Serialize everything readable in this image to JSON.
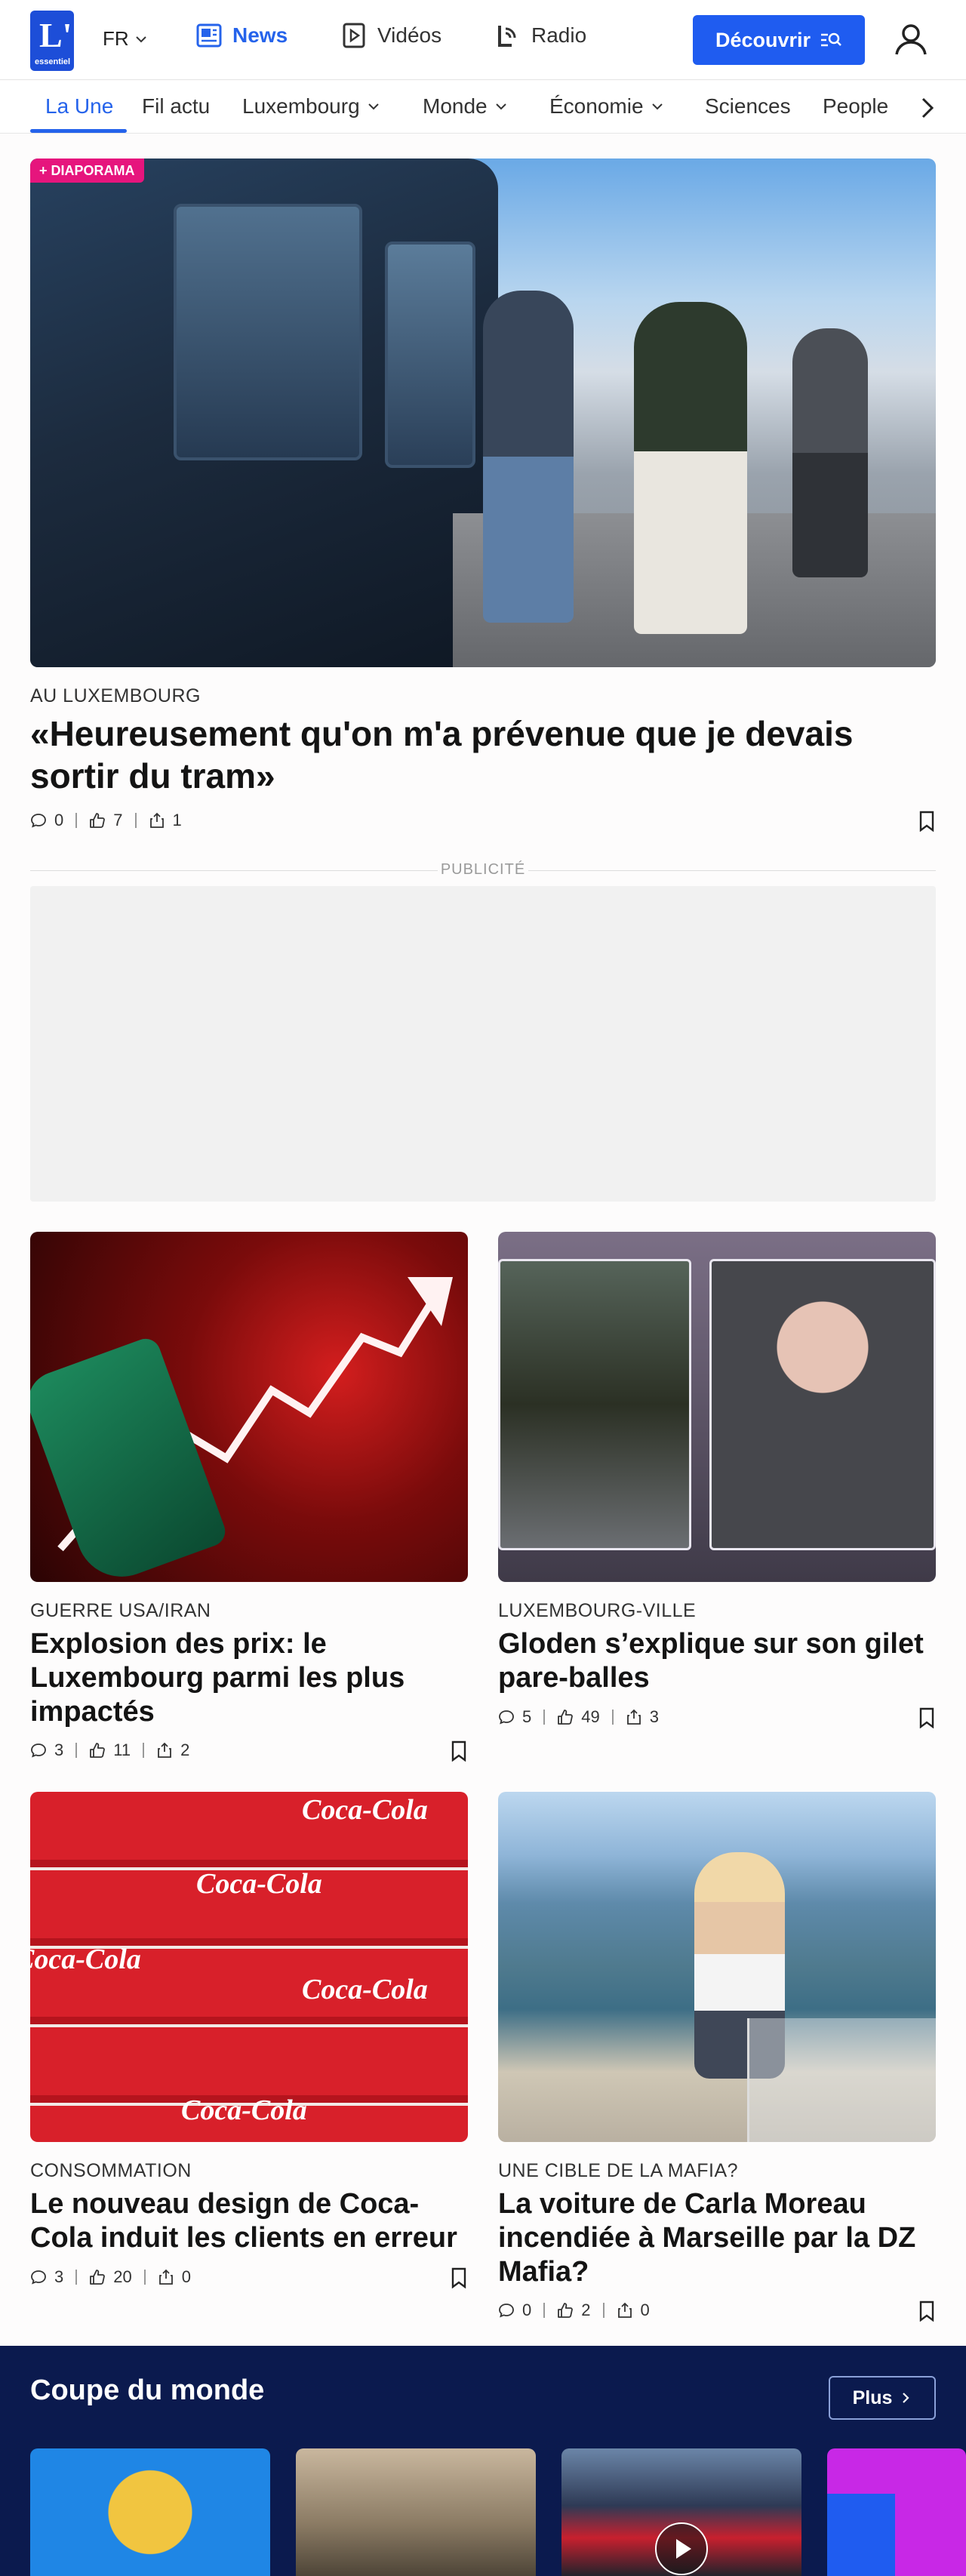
{
  "header": {
    "logo_big": "L'",
    "logo_small": "essentiel",
    "lang": "FR",
    "nav": [
      {
        "label": "News",
        "active": true
      },
      {
        "label": "Vidéos",
        "active": false
      },
      {
        "label": "Radio",
        "active": false
      }
    ],
    "discover_label": "Découvrir"
  },
  "categories": [
    {
      "label": "La Une",
      "active": true,
      "dropdown": false
    },
    {
      "label": "Fil actu",
      "active": false,
      "dropdown": false
    },
    {
      "label": "Luxembourg",
      "active": false,
      "dropdown": true
    },
    {
      "label": "Monde",
      "active": false,
      "dropdown": true
    },
    {
      "label": "Économie",
      "active": false,
      "dropdown": true
    },
    {
      "label": "Sciences",
      "active": false,
      "dropdown": false
    },
    {
      "label": "People",
      "active": false,
      "dropdown": false
    }
  ],
  "hero": {
    "badge": "+ DIAPORAMA",
    "kicker": "AU LUXEMBOURG",
    "title": "«Heureusement qu'on m'a prévenue que je devais sortir du tram»",
    "comments": "0",
    "likes": "7",
    "shares": "1"
  },
  "ad_label": "PUBLICITÉ",
  "articles": [
    {
      "kicker": "GUERRE USA/IRAN",
      "title": "Explosion des prix: le Luxembourg parmi les plus impactés",
      "comments": "3",
      "likes": "11",
      "shares": "2"
    },
    {
      "kicker": "LUXEMBOURG-VILLE",
      "title": "Gloden s’explique sur son gilet pare-balles",
      "comments": "5",
      "likes": "49",
      "shares": "3"
    },
    {
      "kicker": "CONSOMMATION",
      "title": "Le nouveau design de Coca-Cola induit les clients en erreur",
      "comments": "3",
      "likes": "20",
      "shares": "0"
    },
    {
      "kicker": "UNE CIBLE DE LA MAFIA?",
      "title": "La voiture de Carla Moreau incendiée à Marseille par la DZ Mafia?",
      "comments": "0",
      "likes": "2",
      "shares": "0"
    }
  ],
  "coca_logo_text": "Coca-Cola",
  "worldcup": {
    "title": "Coupe du monde",
    "more_label": "Plus"
  },
  "colors": {
    "accent": "#1f5cf0",
    "badge": "#e6157d",
    "section_bg": "#0b1a4e"
  }
}
